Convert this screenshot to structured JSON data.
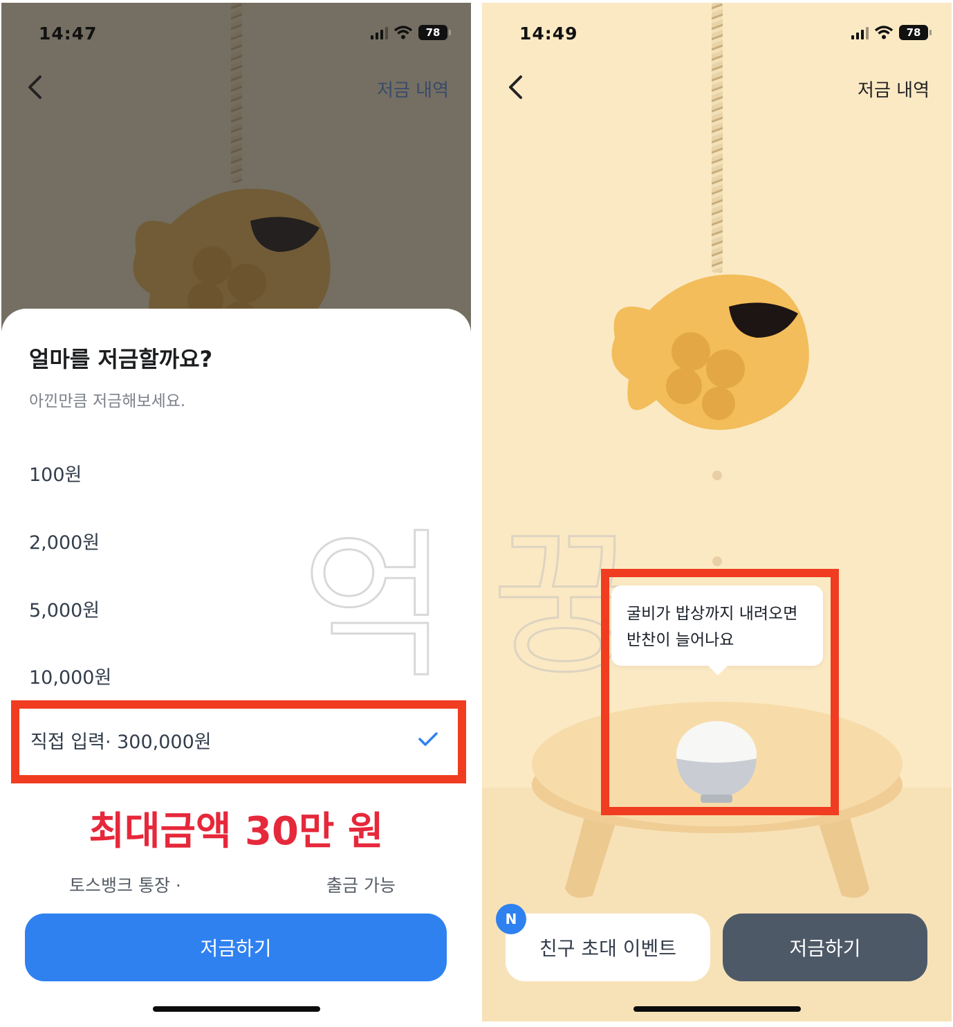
{
  "left": {
    "status": {
      "time": "14:47",
      "battery": "78"
    },
    "header": {
      "history_label": "저금 내역"
    },
    "sheet": {
      "title": "얼마를 저금할까요?",
      "subtitle": "아낀만큼 저금해보세요.",
      "amounts": [
        "100원",
        "2,000원",
        "5,000원",
        "10,000원"
      ],
      "selected_label": "직접 입력· 300,000원",
      "sketch_text": "억",
      "max_amount": "최대금액 30만 원",
      "account_name": "토스뱅크 통장 ·",
      "withdraw_label": "출금 가능",
      "save_button": "저금하기"
    }
  },
  "right": {
    "status": {
      "time": "14:49",
      "battery": "78"
    },
    "header": {
      "history_label": "저금 내역"
    },
    "sketch_text": "꿍",
    "tooltip": {
      "line1": "굴비가 밥상까지 내려오면",
      "line2": "반찬이 늘어나요"
    },
    "badge": "N",
    "invite_button": "친구 초대 이벤트",
    "save_button": "저금하기"
  },
  "colors": {
    "primary_blue": "#2f81f0",
    "highlight_red": "#f03c20",
    "max_amount_red": "#e6283b",
    "dark_button": "#4e5968",
    "background_cream": "#fbe9c4"
  },
  "icons": [
    "back-chevron-icon",
    "signal-icon",
    "wifi-icon",
    "battery-icon",
    "check-icon",
    "fish-icon",
    "rice-bowl-icon"
  ]
}
